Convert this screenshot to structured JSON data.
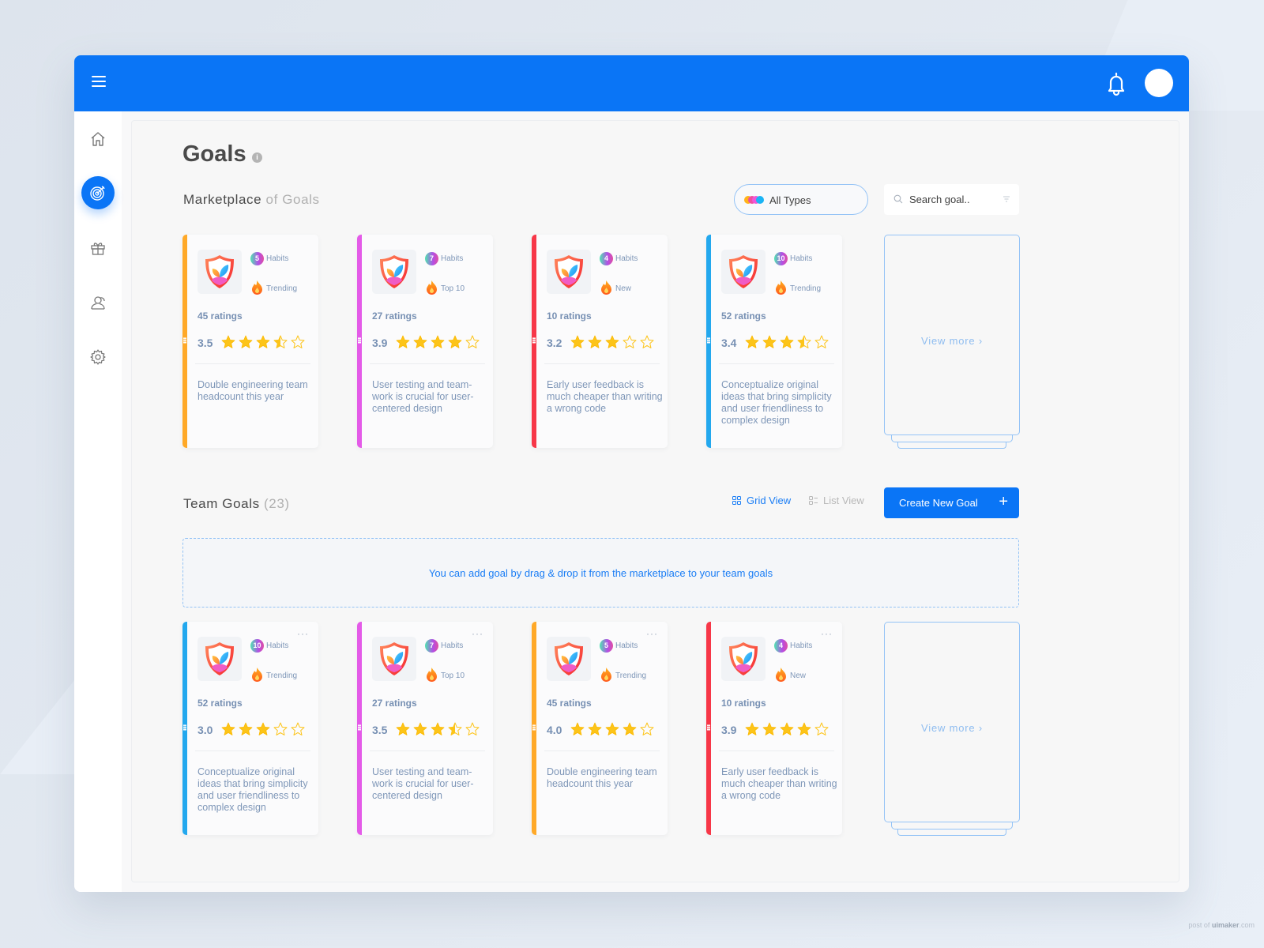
{
  "header": {
    "menu_icon": "hamburger-icon",
    "bell_icon": "bell-icon",
    "avatar": "user-avatar"
  },
  "sidebar": {
    "items": [
      {
        "name": "home",
        "icon": "home-icon",
        "active": false
      },
      {
        "name": "goals",
        "icon": "target-icon",
        "active": true
      },
      {
        "name": "rewards",
        "icon": "gift-icon",
        "active": false
      },
      {
        "name": "people",
        "icon": "users-icon",
        "active": false
      },
      {
        "name": "settings",
        "icon": "gear-icon",
        "active": false
      }
    ]
  },
  "page": {
    "title": "Goals",
    "info_icon": "i"
  },
  "marketplace": {
    "title_main": "Marketplace",
    "title_muted": "of Goals",
    "types_filter": {
      "label": "All Types",
      "dot_colors": [
        "#ffb31a",
        "#f04ea0",
        "#ef57d9",
        "#1ab4f5"
      ]
    },
    "search": {
      "placeholder": "Search goal..",
      "value": ""
    },
    "cards": [
      {
        "habits": "5",
        "habits_label": "Habits",
        "tag": "Trending",
        "ratings": "45 ratings",
        "rating": "3.5",
        "stars": 3.5,
        "desc": "Double engineering team headcount this year",
        "color": "#ffa928"
      },
      {
        "habits": "7",
        "habits_label": "Habits",
        "tag": "Top 10",
        "ratings": "27 ratings",
        "rating": "3.9",
        "stars": 4,
        "desc": "User testing and team-work is crucial for user-centered design",
        "color": "#e45be8"
      },
      {
        "habits": "4",
        "habits_label": "Habits",
        "tag": "New",
        "ratings": "10 ratings",
        "rating": "3.2",
        "stars": 3,
        "desc": "Early user feedback is much cheaper than writing a wrong code",
        "color": "#f73748"
      },
      {
        "habits": "10",
        "habits_label": "Habits",
        "tag": "Trending",
        "ratings": "52 ratings",
        "rating": "3.4",
        "stars": 3.5,
        "desc": "Conceptualize original ideas that bring simplicity and user friendliness to complex design",
        "color": "#23a8ee"
      }
    ],
    "view_more": "View more ›"
  },
  "team_goals": {
    "title_main": "Team Goals",
    "title_count": "(23)",
    "grid_view": "Grid View",
    "list_view": "List View",
    "create_button": "Create New Goal",
    "create_icon": "+",
    "dropzone_text": "You can add goal by drag & drop it from the marketplace to your team goals",
    "cards": [
      {
        "habits": "10",
        "habits_label": "Habits",
        "tag": "Trending",
        "ratings": "52 ratings",
        "rating": "3.0",
        "stars": 3,
        "desc": "Conceptualize original ideas that bring simplicity and user friendliness to complex design",
        "color": "#23a8ee"
      },
      {
        "habits": "7",
        "habits_label": "Habits",
        "tag": "Top 10",
        "ratings": "27 ratings",
        "rating": "3.5",
        "stars": 3.5,
        "desc": "User testing and team-work is crucial for user-centered design",
        "color": "#e45be8"
      },
      {
        "habits": "5",
        "habits_label": "Habits",
        "tag": "Trending",
        "ratings": "45 ratings",
        "rating": "4.0",
        "stars": 4,
        "desc": "Double engineering team headcount this year",
        "color": "#ffa928"
      },
      {
        "habits": "4",
        "habits_label": "Habits",
        "tag": "New",
        "ratings": "10 ratings",
        "rating": "3.9",
        "stars": 4,
        "desc": "Early user feedback is much cheaper than writing a wrong code",
        "color": "#f73748"
      }
    ],
    "more_menu": "···",
    "view_more": "View more ›"
  },
  "watermark": {
    "prefix": "post of",
    "brand": "uimaker",
    "suffix": ".com"
  },
  "colors": {
    "brand": "#0a75f6",
    "accent_light": "#94c3f6"
  }
}
